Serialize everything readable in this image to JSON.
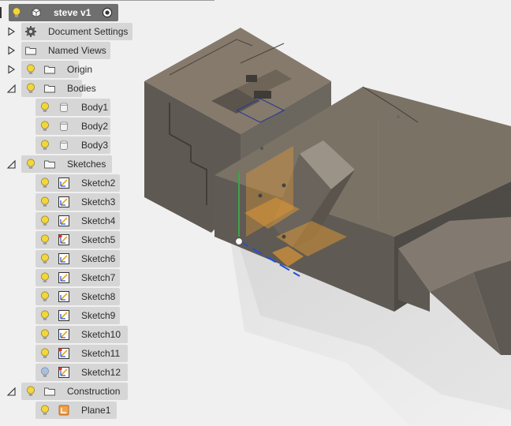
{
  "browser": {
    "root": {
      "label": "steve v1"
    },
    "items": [
      {
        "id": "doc",
        "label": "Document Settings",
        "level": 0,
        "arrow": "collapsed",
        "bulb": false,
        "icon": "gear-icon"
      },
      {
        "id": "views",
        "label": "Named Views",
        "level": 0,
        "arrow": "collapsed",
        "bulb": false,
        "icon": "folder-icon"
      },
      {
        "id": "origin",
        "label": "Origin",
        "level": 0,
        "arrow": "collapsed",
        "bulb": true,
        "icon": "folder-icon"
      },
      {
        "id": "bodies",
        "label": "Bodies",
        "level": 0,
        "arrow": "expanded",
        "bulb": true,
        "icon": "folder-icon"
      },
      {
        "id": "body1",
        "label": "Body1",
        "level": 1,
        "bulb": true,
        "icon": "body-icon"
      },
      {
        "id": "body2",
        "label": "Body2",
        "level": 1,
        "bulb": true,
        "icon": "body-icon"
      },
      {
        "id": "body3",
        "label": "Body3",
        "level": 1,
        "bulb": true,
        "icon": "body-icon"
      },
      {
        "id": "sketches",
        "label": "Sketches",
        "level": 0,
        "arrow": "expanded",
        "bulb": true,
        "icon": "folder-icon"
      },
      {
        "id": "s2",
        "label": "Sketch2",
        "level": 1,
        "bulb": true,
        "icon": "sketch-icon"
      },
      {
        "id": "s3",
        "label": "Sketch3",
        "level": 1,
        "bulb": true,
        "icon": "sketch-icon"
      },
      {
        "id": "s4",
        "label": "Sketch4",
        "level": 1,
        "bulb": true,
        "icon": "sketch-icon"
      },
      {
        "id": "s5",
        "label": "Sketch5",
        "level": 1,
        "bulb": true,
        "icon": "sketch-warn-icon"
      },
      {
        "id": "s6",
        "label": "Sketch6",
        "level": 1,
        "bulb": true,
        "icon": "sketch-icon"
      },
      {
        "id": "s7",
        "label": "Sketch7",
        "level": 1,
        "bulb": true,
        "icon": "sketch-icon"
      },
      {
        "id": "s8",
        "label": "Sketch8",
        "level": 1,
        "bulb": true,
        "icon": "sketch-icon"
      },
      {
        "id": "s9",
        "label": "Sketch9",
        "level": 1,
        "bulb": true,
        "icon": "sketch-icon"
      },
      {
        "id": "s10",
        "label": "Sketch10",
        "level": 1,
        "bulb": true,
        "icon": "sketch-icon"
      },
      {
        "id": "s11",
        "label": "Sketch11",
        "level": 1,
        "bulb": true,
        "icon": "sketch-warn-icon"
      },
      {
        "id": "s12",
        "label": "Sketch12",
        "level": 1,
        "bulb": "off",
        "icon": "sketch-warn-icon"
      },
      {
        "id": "construction",
        "label": "Construction",
        "level": 0,
        "arrow": "expanded",
        "bulb": true,
        "icon": "folder-icon"
      },
      {
        "id": "plane1",
        "label": "Plane1",
        "level": 1,
        "bulb": true,
        "icon": "plane-icon"
      }
    ]
  },
  "colors": {
    "bulb_on": "#f2d63a",
    "bulb_off": "#a9bfdc",
    "sketch_accent": "#e8a21b",
    "sketch_warn": "#d5362b",
    "axis_blue": "#1f4fe0",
    "axis_green": "#3da34b",
    "plane_orange": "#f0a030",
    "model_gray": "#5c5753"
  }
}
